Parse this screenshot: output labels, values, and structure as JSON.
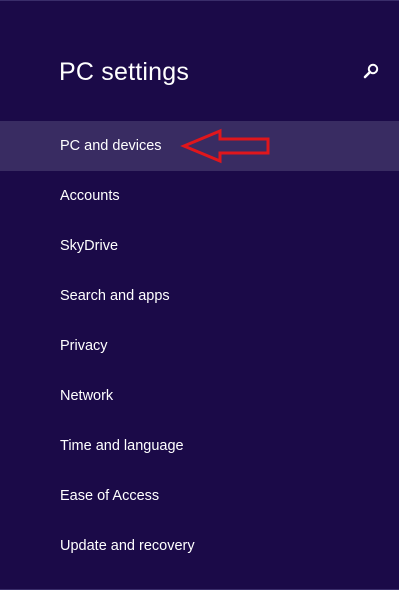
{
  "window": {
    "title": "PC settings"
  },
  "colors": {
    "background": "#1b0a48",
    "selected_item_background": "#392c62",
    "text": "#ffffff",
    "annotation_arrow": "#e0161c"
  },
  "header": {
    "search_icon": "search-icon"
  },
  "nav": {
    "selected_index": 0,
    "items": [
      {
        "label": "PC and devices"
      },
      {
        "label": "Accounts"
      },
      {
        "label": "SkyDrive"
      },
      {
        "label": "Search and apps"
      },
      {
        "label": "Privacy"
      },
      {
        "label": "Network"
      },
      {
        "label": "Time and language"
      },
      {
        "label": "Ease of Access"
      },
      {
        "label": "Update and recovery"
      }
    ]
  },
  "annotation": {
    "shape": "left-pointing-arrow",
    "target": "PC and devices"
  }
}
